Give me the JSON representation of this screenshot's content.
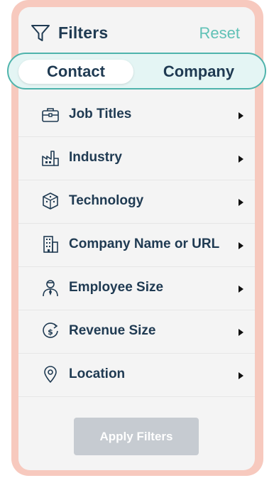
{
  "header": {
    "title": "Filters",
    "reset_label": "Reset"
  },
  "tabs": [
    {
      "label": "Contact",
      "active": true
    },
    {
      "label": "Company",
      "active": false
    }
  ],
  "filters": [
    {
      "label": "Job Titles",
      "icon": "briefcase-icon"
    },
    {
      "label": "Industry",
      "icon": "factory-icon"
    },
    {
      "label": "Technology",
      "icon": "technology-cube-icon"
    },
    {
      "label": "Company Name or URL",
      "icon": "building-icon"
    },
    {
      "label": "Employee Size",
      "icon": "employee-icon"
    },
    {
      "label": "Revenue Size",
      "icon": "revenue-icon"
    },
    {
      "label": "Location",
      "icon": "location-pin-icon"
    }
  ],
  "apply_label": "Apply Filters",
  "colors": {
    "frame": "#f7c9be",
    "panel": "#f4f4f4",
    "accent": "#5fc1b6",
    "text": "#1f3a52",
    "button_disabled": "#c6cbd1"
  }
}
